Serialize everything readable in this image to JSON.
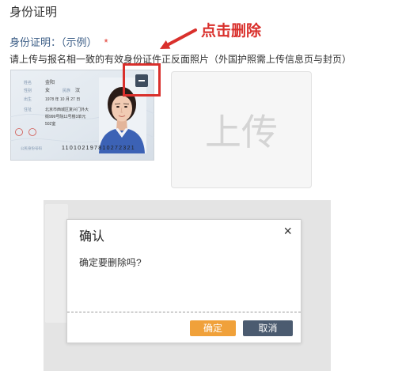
{
  "section": {
    "title": "身份证明"
  },
  "field": {
    "label": "身份证明：（示例）",
    "required_mark": "*",
    "hint": "请上传与报名相一致的有效身份证件正反面照片（外国护照需上传信息页与封页）"
  },
  "annotation": {
    "text": "点击删除",
    "color": "#d9302c"
  },
  "id_card": {
    "name_label": "姓名",
    "name": "金阳",
    "sex_label": "性别",
    "sex": "女",
    "ethnicity_label": "民族",
    "ethnicity": "汉",
    "birth_label": "出生",
    "birth": "1978 年 10 月 27 日",
    "address_label": "住址",
    "address_lines": [
      "北京市西城区复兴门外大",
      "街999号院11号楼3单元",
      "502室"
    ],
    "id_number_label": "公民身份号码",
    "id_number": "110102197810272321"
  },
  "delete_button": {
    "icon": "minus-icon"
  },
  "upload": {
    "label": "上传"
  },
  "dialog": {
    "title": "确认",
    "close_glyph": "×",
    "close_icon": "close-icon",
    "message": "确定要删除吗?",
    "confirm_label": "确定",
    "cancel_label": "取消"
  },
  "colors": {
    "annotation_red": "#d9302c",
    "required_red": "#e0352b",
    "label_blue": "#3b5d86",
    "confirm_orange": "#f0a13a",
    "cancel_slate": "#4b5b70",
    "delete_button_bg": "#3e4d5f",
    "backdrop_gray": "#e4e4e4"
  }
}
